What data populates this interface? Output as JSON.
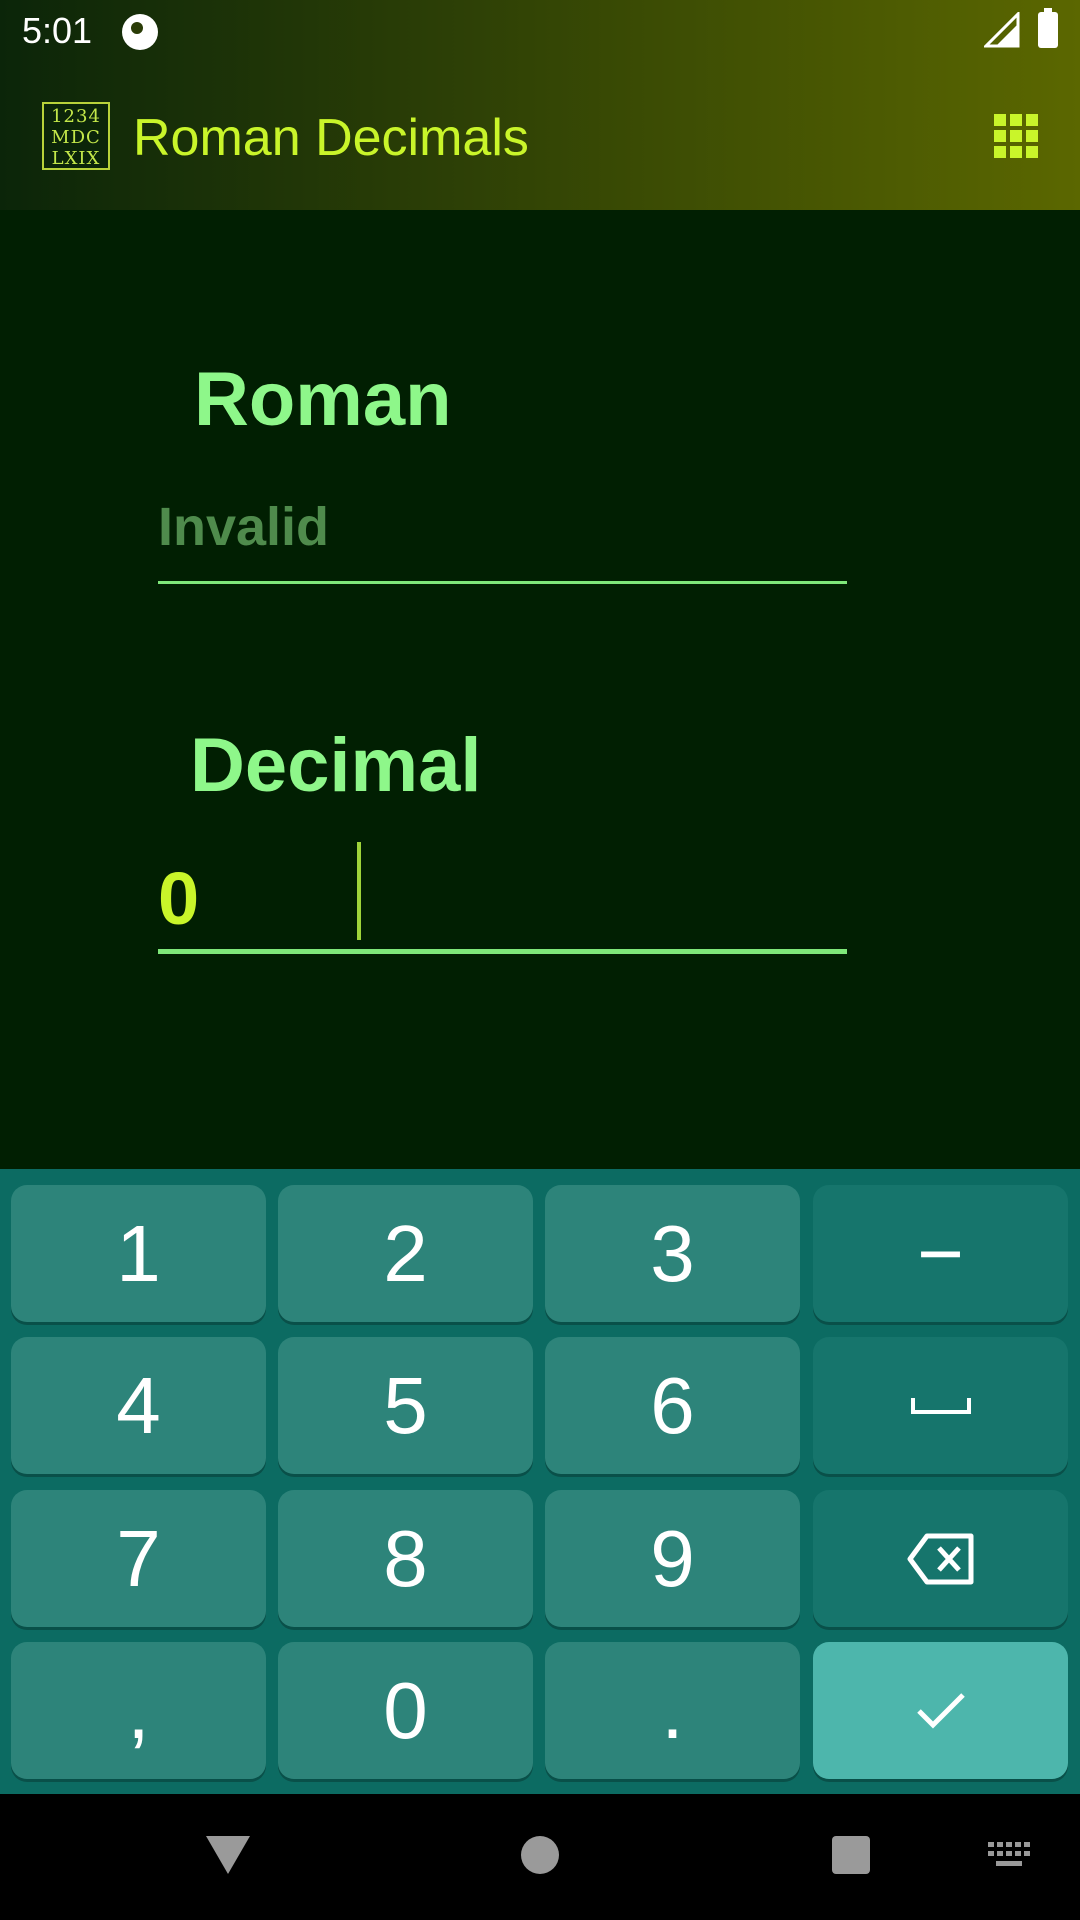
{
  "status_bar": {
    "time": "5:01"
  },
  "app_bar": {
    "logo_lines": [
      "1234",
      "MDC",
      "LXIX"
    ],
    "title": "Roman Decimals"
  },
  "form": {
    "roman_label": "Roman",
    "roman_placeholder": "Invalid",
    "decimal_label": "Decimal",
    "decimal_value": "0"
  },
  "keyboard": {
    "keys": [
      "1",
      "2",
      "3",
      "−",
      "4",
      "5",
      "6",
      "␣",
      "7",
      "8",
      "9",
      "backspace",
      ",",
      "0",
      ".",
      "enter"
    ]
  },
  "colors": {
    "background": "#011f02",
    "label": "#8ef78a",
    "accent": "#c9f52a",
    "keyboard_bg": "#0c6b62",
    "key_bg": "#2d847a",
    "enter_key": "#4db6ac"
  }
}
